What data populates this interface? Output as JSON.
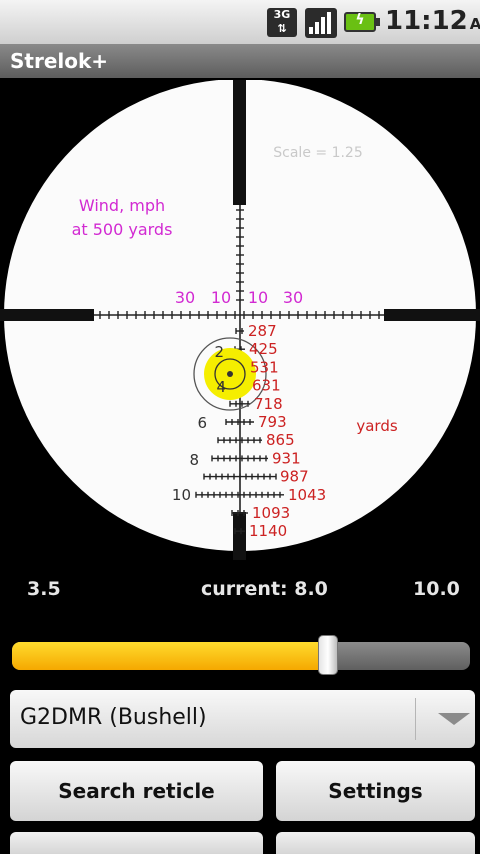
{
  "status_bar": {
    "network": "3G",
    "time": "11:12",
    "ampm": "AM",
    "icons": [
      "3g-icon",
      "signal-icon",
      "battery-charging-icon"
    ]
  },
  "app": {
    "title": "Strelok+"
  },
  "reticle": {
    "scale_text": "Scale = 1.25",
    "wind_title": "Wind, mph",
    "wind_subtitle": "at 500 yards",
    "wind_left": [
      "30",
      "10"
    ],
    "wind_right": [
      "10",
      "30"
    ],
    "ranges": [
      "287",
      "425",
      "531",
      "631",
      "718",
      "793",
      "865",
      "931",
      "987",
      "1043",
      "1093",
      "1140"
    ],
    "stadia": [
      "2",
      "4",
      "6",
      "8",
      "10"
    ],
    "unit": "yards"
  },
  "zoom": {
    "min": "3.5",
    "current_label": "current: 8.0",
    "max": "10.0",
    "current_fraction": 0.69
  },
  "reticle_select": {
    "value": "G2DMR (Bushell)"
  },
  "buttons": {
    "search": "Search reticle",
    "settings": "Settings"
  }
}
